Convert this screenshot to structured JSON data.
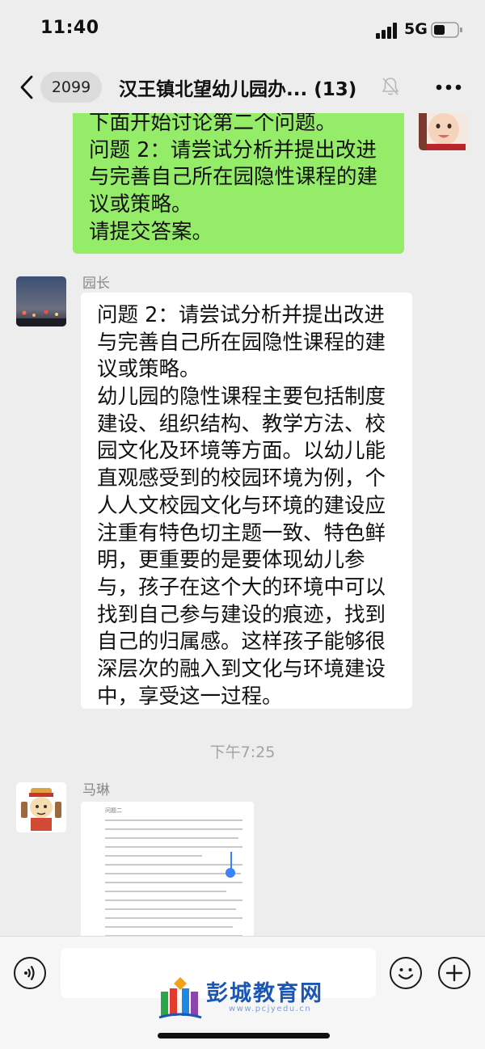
{
  "status_bar": {
    "time": "11:40",
    "network": "5G"
  },
  "nav": {
    "unread_count": "2099",
    "title": "汉王镇北望幼儿园办...",
    "member_count": "(13)"
  },
  "messages": [
    {
      "side": "right",
      "bubble_color": "#95ec69",
      "lines": [
        "下面开始讨论第二个问题。",
        "问题 2：请尝试分析并提出改进",
        "与完善自己所在园隐性课程的建",
        "议或策略。",
        "请提交答案。"
      ]
    },
    {
      "side": "left",
      "sender": "园长",
      "bubble_color": "#ffffff",
      "lines": [
        "问题 2：请尝试分析并提出改进",
        "与完善自己所在园隐性课程的建",
        "议或策略。",
        "幼儿园的隐性课程主要包括制度",
        "建设、组织结构、教学方法、校",
        "园文化及环境等方面。以幼儿能",
        "直观感受到的校园环境为例，个",
        "人人文校园文化与环境的建设应",
        "注重有特色切主题一致、特色鲜",
        "明，更重要的是要体现幼儿参",
        "与，孩子在这个大的环境中可以",
        "找到自己参与建设的痕迹，找到",
        "自己的归属感。这样孩子能够很",
        "深层次的融入到文化与环境建设",
        "中，享受这一过程。"
      ]
    },
    {
      "type": "time",
      "text": "下午7:25"
    },
    {
      "side": "left",
      "sender": "马琳",
      "type": "document-image",
      "doc_heading": "问题二"
    }
  ],
  "watermark": {
    "text": "彭城教育网",
    "url": "www.pcjyedu.cn"
  },
  "colors": {
    "background": "#ededed",
    "my_bubble": "#95ec69",
    "other_bubble": "#ffffff",
    "watermark": "#1a57b5"
  }
}
